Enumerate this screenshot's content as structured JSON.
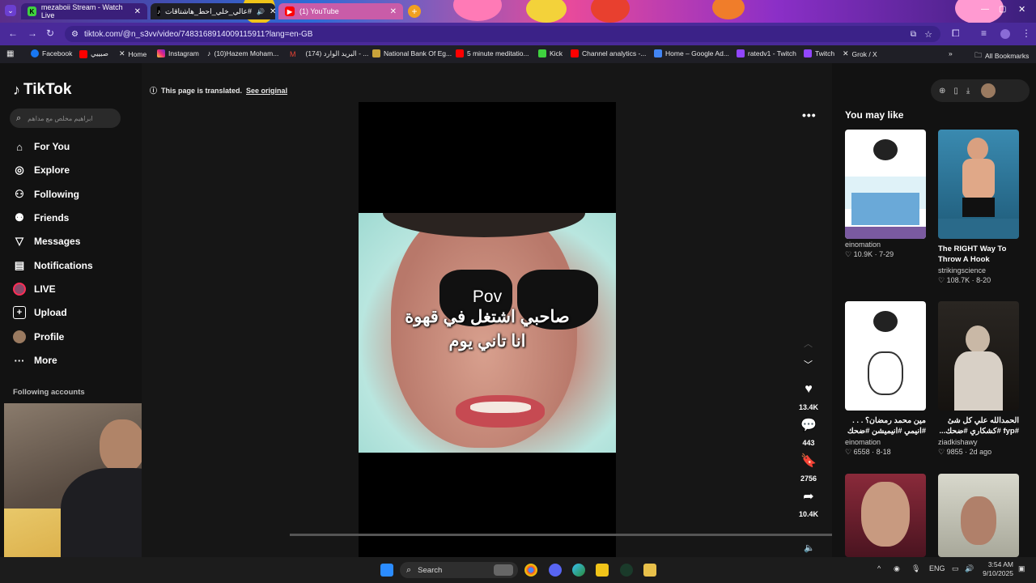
{
  "browser": {
    "tabs": [
      {
        "label": "mezaboii Stream - Watch Live",
        "color": "#3fd13f"
      },
      {
        "label": "عالي_خلي_احط_هاشتاقات#",
        "color": "#ffffff"
      },
      {
        "label": "(1) YouTube",
        "color": "#ff0000"
      }
    ],
    "url": "tiktok.com/@n_s3vv/video/7483168914009115911?lang=en-GB",
    "bookmarks": [
      "Facebook",
      "صبييي",
      "Home",
      "Instagram",
      "(10)Hazem Moham...",
      "(174) البريد الوارد - ...",
      "National Bank Of Eg...",
      "5 minute meditatio...",
      "Kick",
      "Channel analytics -...",
      "Home – Google Ad...",
      "ratedv1 - Twitch",
      "Twitch",
      "Grok / X"
    ],
    "all_bookmarks": "All Bookmarks"
  },
  "sidebar": {
    "logo": "TikTok",
    "search_placeholder": "ابراهيم مخلص مع مداهم",
    "items": [
      {
        "label": "For You",
        "icon": "home-icon"
      },
      {
        "label": "Explore",
        "icon": "compass-icon"
      },
      {
        "label": "Following",
        "icon": "following-icon"
      },
      {
        "label": "Friends",
        "icon": "friends-icon"
      },
      {
        "label": "Messages",
        "icon": "messages-icon"
      },
      {
        "label": "Notifications",
        "icon": "notifications-icon"
      },
      {
        "label": "LIVE",
        "icon": "live-icon"
      },
      {
        "label": "Upload",
        "icon": "upload-icon"
      },
      {
        "label": "Profile",
        "icon": "profile-icon"
      },
      {
        "label": "More",
        "icon": "more-icon"
      }
    ],
    "following_accounts": "Following accounts"
  },
  "main": {
    "translated_text": "This page is translated.",
    "see_original": "See original",
    "caption_line1": "Pov",
    "caption_line2": "صاحبي اشتغل في قهوة",
    "caption_line3": "انا تاني يوم",
    "likes": "13.4K",
    "comments": "443",
    "saves": "2756",
    "shares": "10.4K"
  },
  "recommendations": {
    "title": "You may like",
    "cards": [
      {
        "title": "",
        "author": "einomation",
        "likes": "10.9K",
        "date": "7-29"
      },
      {
        "title": "The RIGHT Way To Throw A Hook",
        "author": "strikingscience",
        "likes": "108.7K",
        "date": "8-20"
      },
      {
        "title": "مين محمد رمضان؟ . . . #انيمي #انيميشن #ضحك",
        "author": "einomation",
        "likes": "6558",
        "date": "8-18"
      },
      {
        "title": "الحمدالله علي كل شئ #fyp #كشكاري #ضحك...",
        "author": "ziadkishawy",
        "likes": "9855",
        "date": "2d ago"
      },
      {
        "title": "",
        "author": "",
        "likes": "",
        "date": ""
      },
      {
        "title": "",
        "author": "",
        "likes": "",
        "date": ""
      }
    ]
  },
  "taskbar": {
    "search_placeholder": "Search",
    "lang": "ENG",
    "time": "3:54 AM",
    "date": "9/10/2025"
  }
}
